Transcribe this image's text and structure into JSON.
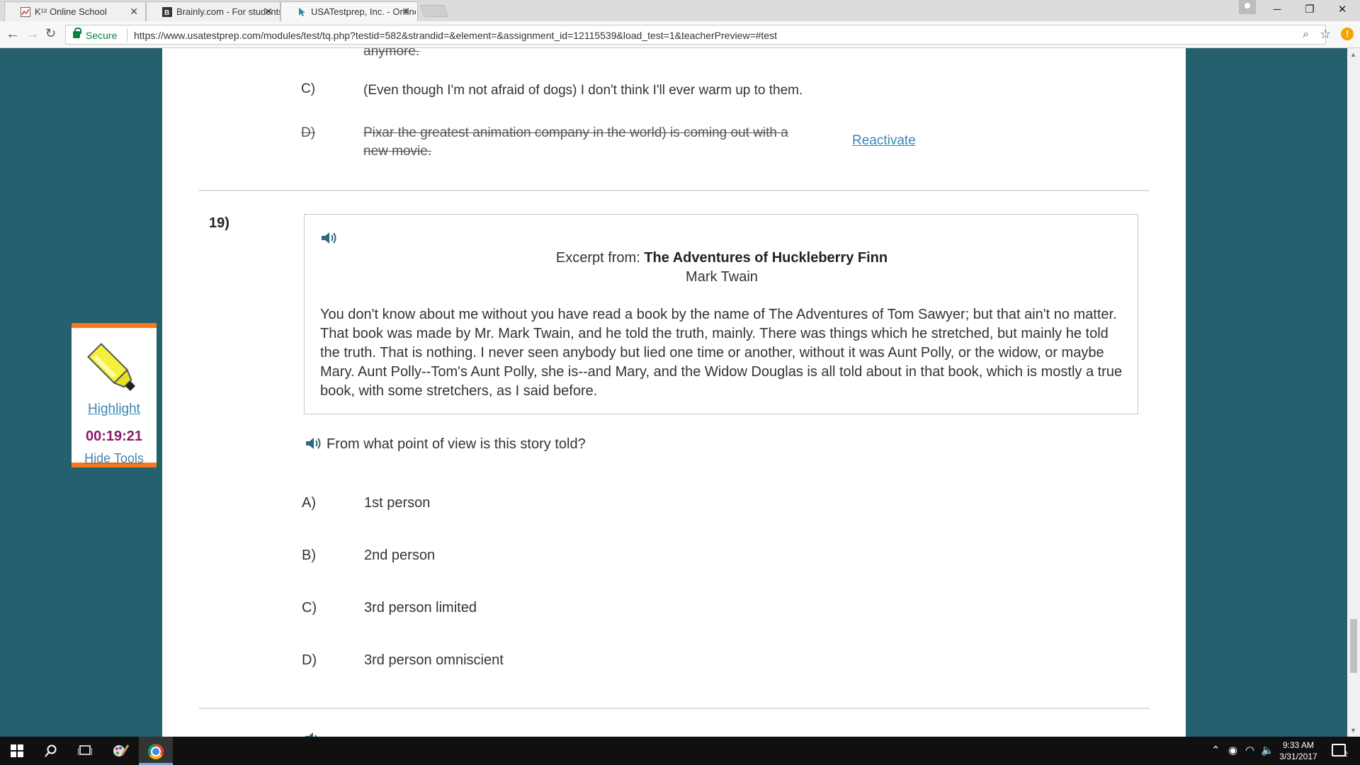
{
  "browser": {
    "tabs": [
      {
        "title": "K¹² Online School",
        "active": false
      },
      {
        "title": "Brainly.com - For students",
        "active": false
      },
      {
        "title": "USATestprep, Inc. - Online",
        "active": true
      }
    ],
    "secure_label": "Secure",
    "url": "https://www.usatestprep.com/modules/test/tq.php?testid=582&strandid=&element=&assignment_id=12115539&load_test=1&teacherPreview=#test",
    "menu_badge": "!"
  },
  "previous_question": {
    "strike_tail": "anymore.",
    "option_c": {
      "letter": "C)",
      "text": "(Even though I'm not afraid of dogs) I don't think I'll ever warm up to them."
    },
    "option_d": {
      "letter": "D)",
      "line1": "Pixar the greatest animation company in the world) is coming out with a",
      "line2": "new movie."
    },
    "reactivate_label": "Reactivate"
  },
  "question": {
    "number": "19)",
    "excerpt_prefix": "Excerpt from: ",
    "excerpt_title": "The Adventures of Huckleberry Finn",
    "author": "Mark Twain",
    "passage": "You don't know about me without you have read a book by the name of The Adventures of Tom Sawyer; but that ain't no matter. That book was made by Mr. Mark Twain, and he told the truth, mainly. There was things which he stretched, but mainly he told the truth. That is nothing. I never seen anybody but lied one time or another, without it was Aunt Polly, or the widow, or maybe Mary. Aunt Polly--Tom's Aunt Polly, she is--and Mary, and the Widow Douglas is all told about in that book, which is mostly a true book, with some stretchers, as I said before.",
    "prompt": "From what point of view is this story told?",
    "options": [
      {
        "letter": "A)",
        "text": "1st person"
      },
      {
        "letter": "B)",
        "text": "2nd person"
      },
      {
        "letter": "C)",
        "text": "3rd person limited"
      },
      {
        "letter": "D)",
        "text": "3rd person omniscient"
      }
    ]
  },
  "tools": {
    "highlight_label": "Highlight",
    "timer": "00:19:21",
    "hide_label": "Hide Tools"
  },
  "taskbar": {
    "time": "9:33 AM",
    "date": "3/31/2017",
    "notification_count": "2"
  },
  "colors": {
    "page_background": "#25606f",
    "tools_border": "#f47920",
    "timer": "#8b1a6b",
    "link": "#3b86b5"
  }
}
